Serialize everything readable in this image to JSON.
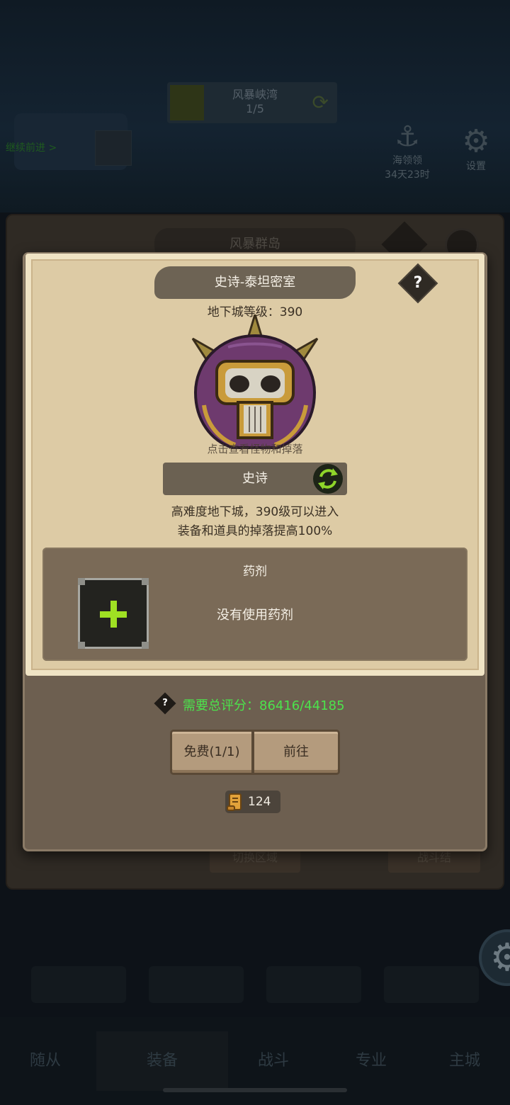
{
  "background": {
    "region_tab": {
      "name": "风暴峡湾",
      "progress": "1/5"
    },
    "quest_link": "继续前进 >",
    "top_right": [
      {
        "label": "海领领",
        "sub": "34天23时",
        "icon": "anchor-icon"
      },
      {
        "label": "设置",
        "icon": "gear-icon"
      }
    ],
    "region_label": "风暴群岛",
    "panel_buttons": [
      "切换区域",
      "战斗结"
    ],
    "bottom_nav": [
      "随从",
      "装备",
      "战斗",
      "专业",
      "主城"
    ]
  },
  "popup": {
    "title": "史诗-泰坦密室",
    "level_label": "地下城等级：",
    "level_value": "390",
    "monster_hint": "点击查看怪物和掉落",
    "difficulty": "史诗",
    "description": [
      "高难度地下城，390级可以进入",
      "装备和道具的掉落提高100%"
    ],
    "potion": {
      "title": "药剂",
      "empty_text": "没有使用药剂"
    },
    "requirement": {
      "text": "需要总评分：86416/44185",
      "color": "#4ce34c"
    },
    "buttons": {
      "free": "免费(1/1)",
      "go": "前往"
    },
    "scroll_count": "124"
  }
}
